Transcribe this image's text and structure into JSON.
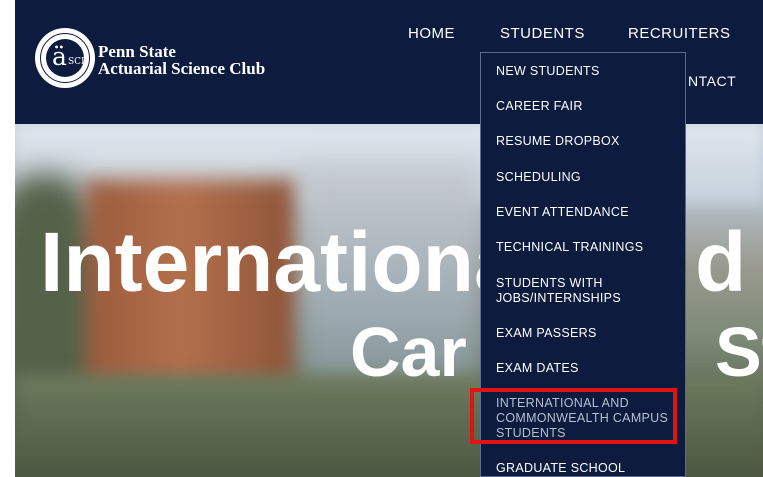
{
  "logo": {
    "seal_letter": "ä",
    "seal_sub": "SCI",
    "name_line1": "Penn State",
    "name_line2": "Actuarial Science Club"
  },
  "nav": {
    "home": "HOME",
    "students": "STUDENTS",
    "recruiters": "RECRUITERS",
    "contact_partial": "NTACT"
  },
  "hero": {
    "line1": "Internationa",
    "line1_right": "d C",
    "line2": "Car",
    "line2_right": "St"
  },
  "dropdown": {
    "items": [
      "NEW STUDENTS",
      "CAREER FAIR",
      "RESUME DROPBOX",
      "SCHEDULING",
      "EVENT ATTENDANCE",
      "TECHNICAL TRAININGS",
      "STUDENTS WITH JOBS/INTERNSHIPS",
      "EXAM PASSERS",
      "EXAM DATES",
      "INTERNATIONAL AND COMMONWEALTH CAMPUS STUDENTS",
      "GRADUATE SCHOOL"
    ]
  },
  "colors": {
    "navy": "#0d1b3e",
    "highlight": "#e11414"
  }
}
